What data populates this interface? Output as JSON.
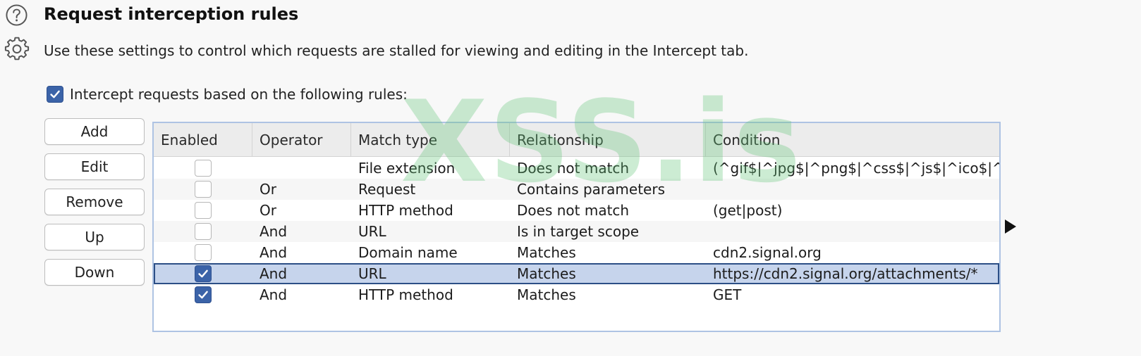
{
  "header": {
    "title": "Request interception rules",
    "description": "Use these settings to control which requests are stalled for viewing and editing in the Intercept tab.",
    "help_icon": "help-circle-icon",
    "settings_icon": "gear-icon"
  },
  "master_checkbox": {
    "label": "Intercept requests based on the following rules:",
    "checked": true
  },
  "buttons": {
    "add": "Add",
    "edit": "Edit",
    "remove": "Remove",
    "up": "Up",
    "down": "Down"
  },
  "table": {
    "columns": [
      "Enabled",
      "Operator",
      "Match type",
      "Relationship",
      "Condition"
    ],
    "rows": [
      {
        "enabled": false,
        "operator": "",
        "match_type": "File extension",
        "relationship": "Does not match",
        "condition": "(^gif$|^jpg$|^png$|^css$|^js$|^ico$|^s..."
      },
      {
        "enabled": false,
        "operator": "Or",
        "match_type": "Request",
        "relationship": "Contains parameters",
        "condition": ""
      },
      {
        "enabled": false,
        "operator": "Or",
        "match_type": "HTTP method",
        "relationship": "Does not match",
        "condition": "(get|post)"
      },
      {
        "enabled": false,
        "operator": "And",
        "match_type": "URL",
        "relationship": "Is in target scope",
        "condition": ""
      },
      {
        "enabled": false,
        "operator": "And",
        "match_type": "Domain name",
        "relationship": "Matches",
        "condition": "cdn2.signal.org"
      },
      {
        "enabled": true,
        "operator": "And",
        "match_type": "URL",
        "relationship": "Matches",
        "condition": "https://cdn2.signal.org/attachments/*",
        "selected": true
      },
      {
        "enabled": true,
        "operator": "And",
        "match_type": "HTTP method",
        "relationship": "Matches",
        "condition": "GET"
      }
    ]
  },
  "watermark": "XSS.is",
  "colors": {
    "checkbox_checked": "#3b63a8",
    "selected_row": "#c6d4ec",
    "table_border": "#aec3e3",
    "watermark": "#60c476"
  }
}
